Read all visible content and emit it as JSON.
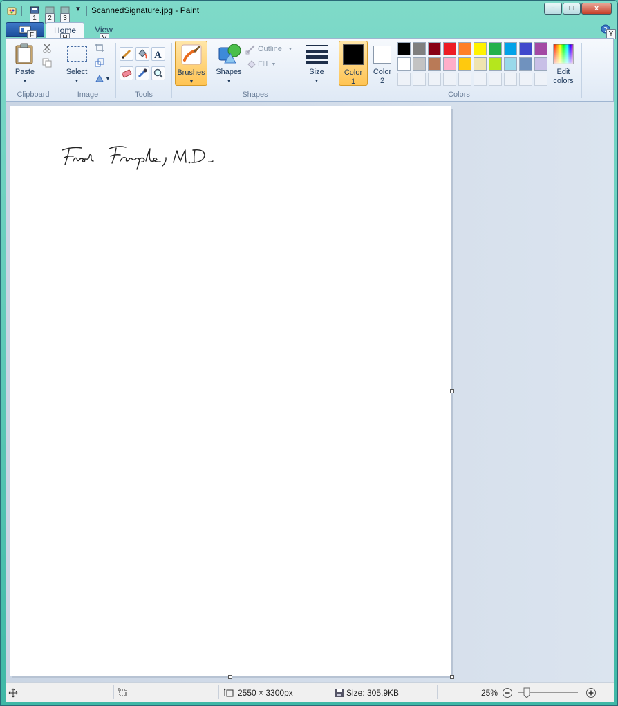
{
  "window": {
    "title": "ScannedSignature.jpg - Paint",
    "sys_buttons": {
      "minimize": "−",
      "maximize": "□",
      "close": "x"
    }
  },
  "quick_access": {
    "keytips": [
      "1",
      "2",
      "3"
    ],
    "file_keytip": "F"
  },
  "tabs": {
    "home": "Home",
    "home_keytip": "H",
    "view": "View",
    "view_keytip": "V",
    "help_keytip": "Y"
  },
  "ribbon": {
    "clipboard": {
      "group": "Clipboard",
      "paste": "Paste"
    },
    "image": {
      "group": "Image",
      "select": "Select"
    },
    "tools": {
      "group": "Tools"
    },
    "brushes": {
      "label": "Brushes"
    },
    "shapes": {
      "group": "Shapes",
      "shapes": "Shapes",
      "outline": "Outline",
      "fill": "Fill"
    },
    "size": {
      "label": "Size"
    },
    "colors": {
      "group": "Colors",
      "color1_line1": "Color",
      "color1_line2": "1",
      "color2_line1": "Color",
      "color2_line2": "2",
      "edit_line1": "Edit",
      "edit_line2": "colors",
      "color1_value": "#000000",
      "color2_value": "#ffffff",
      "palette_row1": [
        "#000000",
        "#7f7f7f",
        "#880015",
        "#ed1c24",
        "#ff7f27",
        "#fff200",
        "#22b14c",
        "#00a2e8",
        "#3f48cc",
        "#a349a4"
      ],
      "palette_row2": [
        "#ffffff",
        "#c3c3c3",
        "#b97a57",
        "#ffaec9",
        "#ffc90e",
        "#efe4b0",
        "#b5e61d",
        "#99d9ea",
        "#7092be",
        "#c8bfe7"
      ]
    }
  },
  "canvas": {
    "signature": "Fred Farple, M.D."
  },
  "status": {
    "dimensions": "2550 × 3300px",
    "size": "Size: 305.9KB",
    "zoom": "25%"
  }
}
